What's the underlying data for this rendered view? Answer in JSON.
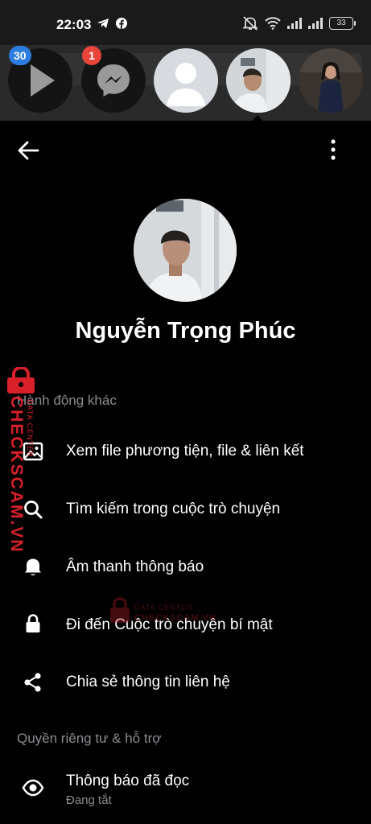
{
  "status_bar": {
    "time": "22:03",
    "battery": "33",
    "left_icons": [
      "telegram-icon",
      "facebook-icon"
    ],
    "right_icons": [
      "mute-icon",
      "wifi-icon",
      "signal-icon",
      "signal-icon"
    ]
  },
  "chat_heads": {
    "badges": {
      "first": "30",
      "second": "1"
    },
    "items": [
      "play-app",
      "messenger-app",
      "blank-avatar",
      "contact-photo",
      "contact-photo-2"
    ]
  },
  "header": {
    "back_icon": "arrow-left-icon",
    "more_icon": "more-vertical-icon"
  },
  "profile": {
    "name": "Nguyễn Trọng Phúc"
  },
  "sections": {
    "other_actions": {
      "title": "Hành động khác",
      "items": [
        {
          "icon": "image-icon",
          "label": "Xem file phương tiện, file & liên kết"
        },
        {
          "icon": "search-icon",
          "label": "Tìm kiếm trong cuộc trò chuyện"
        },
        {
          "icon": "bell-icon",
          "label": "Âm thanh thông báo"
        },
        {
          "icon": "lock-icon",
          "label": "Đi đến Cuộc trò chuyện bí mật"
        },
        {
          "icon": "share-icon",
          "label": "Chia sẻ thông tin liên hệ"
        }
      ]
    },
    "privacy": {
      "title": "Quyền riêng tư & hỗ trợ",
      "items": [
        {
          "icon": "eye-icon",
          "label": "Thông báo đã đọc",
          "sublabel": "Đang tắt"
        }
      ]
    }
  },
  "watermark": {
    "brand": "CHECKSCAM.VN",
    "tagline": "DATA CENTER",
    "colors": {
      "brand_red": "#d8202a"
    }
  },
  "colors": {
    "background": "#000000",
    "secondary_text": "#8a8d91",
    "badge_blue": "#2d7ce0",
    "badge_red": "#e8443c"
  }
}
